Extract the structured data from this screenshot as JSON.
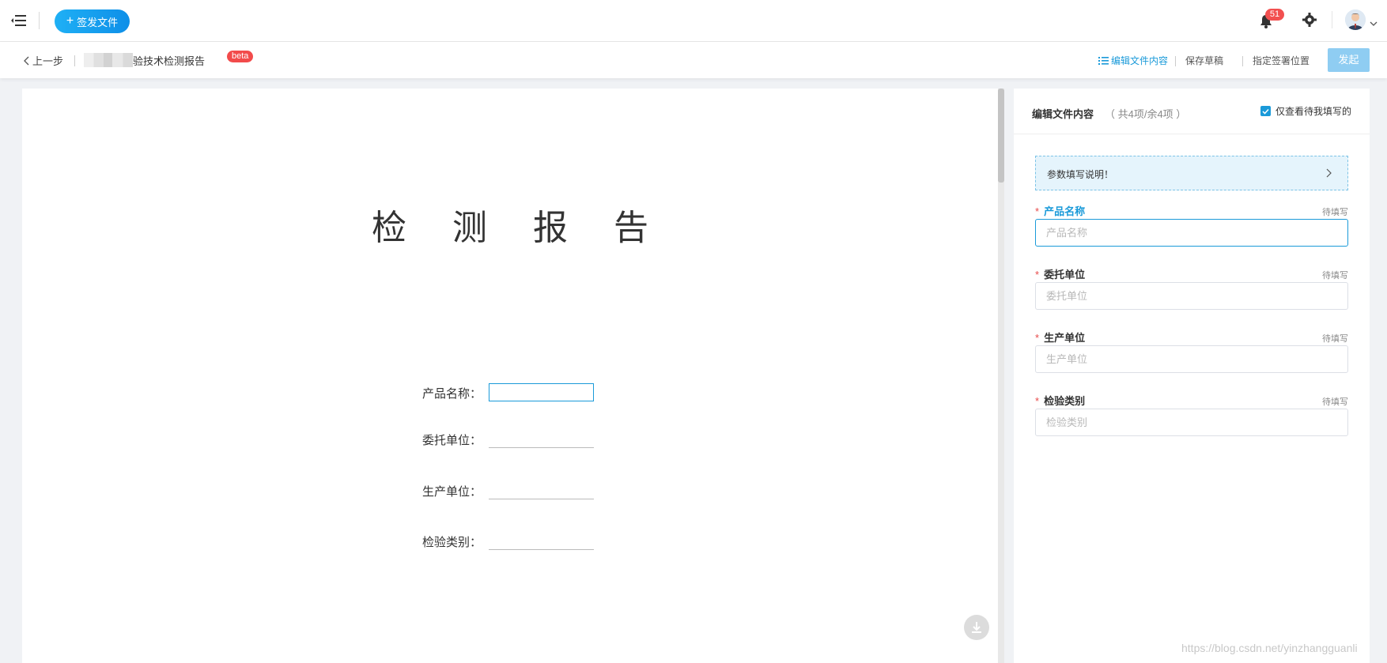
{
  "topbar": {
    "issue_label": "签发文件",
    "notification_count": "51",
    "brand_color": "#1a9ad9"
  },
  "subbar": {
    "back_label": "上一步",
    "doc_name": "验技术检测报告",
    "beta_label": "beta",
    "edit_content_label": "编辑文件内容",
    "save_draft_label": "保存草稿",
    "sign_position_label": "指定签署位置",
    "launch_label": "发起"
  },
  "document": {
    "title": "检 测 报 告",
    "fields": [
      {
        "label": "产品名称："
      },
      {
        "label": "委托单位："
      },
      {
        "label": "生产单位："
      },
      {
        "label": "检验类别："
      }
    ]
  },
  "panel": {
    "title": "编辑文件内容",
    "count": "（ 共4项/余4项 ）",
    "only_mine_label": "仅查看待我填写的",
    "guide_text": "参数填写说明！",
    "params": [
      {
        "label": "产品名称",
        "status": "待填写",
        "placeholder": "产品名称"
      },
      {
        "label": "委托单位",
        "status": "待填写",
        "placeholder": "委托单位"
      },
      {
        "label": "生产单位",
        "status": "待填写",
        "placeholder": "生产单位"
      },
      {
        "label": "检验类别",
        "status": "待填写",
        "placeholder": "检验类别"
      }
    ]
  },
  "watermark": "https://blog.csdn.net/yinzhangguanli"
}
